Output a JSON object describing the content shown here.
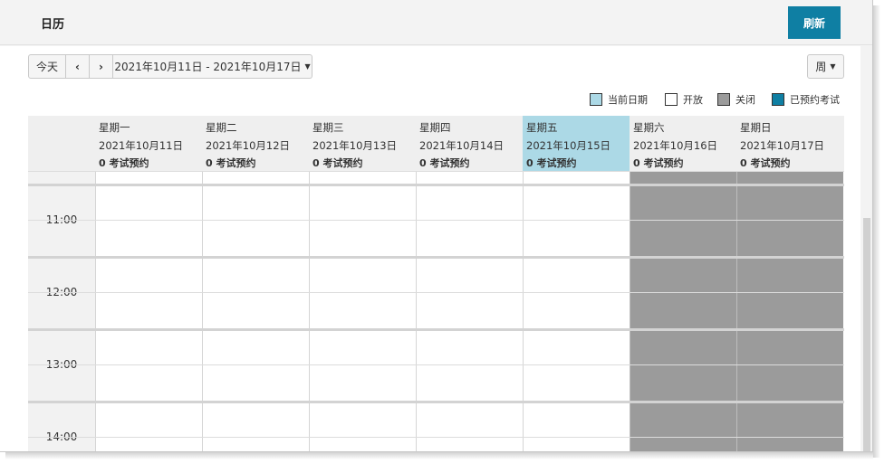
{
  "header": {
    "title": "日历",
    "refresh_label": "刷新"
  },
  "toolbar": {
    "today_label": "今天",
    "prev_label": "‹",
    "next_label": "›",
    "date_range": "2021年10月11日 - 2021年10月17日",
    "view_label": "周"
  },
  "legend": [
    {
      "label": "当前日期",
      "color": "#acd9e6"
    },
    {
      "label": "开放",
      "color": "#ffffff"
    },
    {
      "label": "关闭",
      "color": "#9b9b9b"
    },
    {
      "label": "已预约考试",
      "color": "#0f7fa3"
    }
  ],
  "days": [
    {
      "weekday": "星期一",
      "date": "2021年10月11日",
      "count": "0 考试预约",
      "state": "open"
    },
    {
      "weekday": "星期二",
      "date": "2021年10月12日",
      "count": "0 考试预约",
      "state": "open"
    },
    {
      "weekday": "星期三",
      "date": "2021年10月13日",
      "count": "0 考试预约",
      "state": "open"
    },
    {
      "weekday": "星期四",
      "date": "2021年10月14日",
      "count": "0 考试预约",
      "state": "open"
    },
    {
      "weekday": "星期五",
      "date": "2021年10月15日",
      "count": "0 考试预约",
      "state": "today"
    },
    {
      "weekday": "星期六",
      "date": "2021年10月16日",
      "count": "0 考试预约",
      "state": "closed"
    },
    {
      "weekday": "星期日",
      "date": "2021年10月17日",
      "count": "0 考试预约",
      "state": "closed"
    }
  ],
  "times": [
    "11:00",
    "12:00",
    "13:00",
    "14:00"
  ],
  "colors": {
    "accent": "#0f7fa3",
    "today": "#acd9e6",
    "closed": "#9b9b9b"
  }
}
